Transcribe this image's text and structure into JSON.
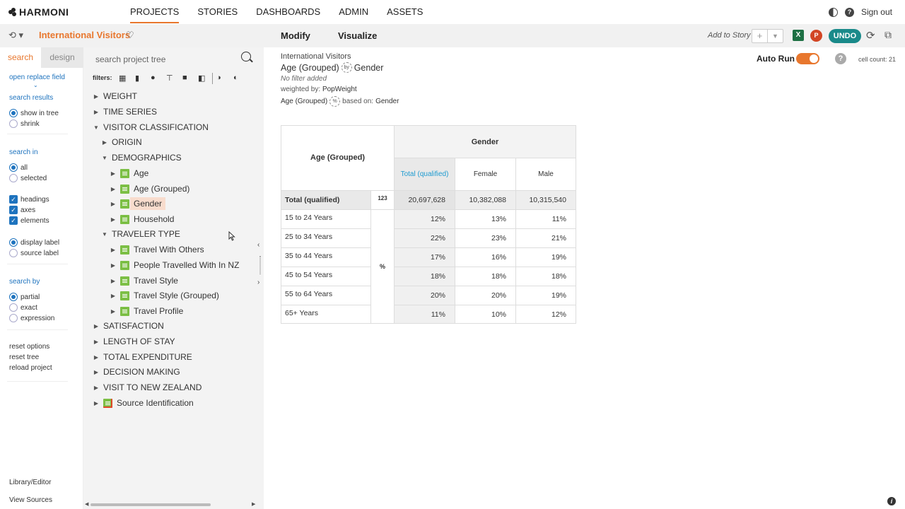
{
  "app": {
    "brand": "HARMONI"
  },
  "nav": {
    "links": [
      "PROJECTS",
      "STORIES",
      "DASHBOARDS",
      "ADMIN",
      "ASSETS"
    ],
    "active": "PROJECTS",
    "signout": "Sign out"
  },
  "toolbar": {
    "project_title": "International Visitors",
    "modify": "Modify",
    "visualize": "Visualize",
    "add_to_story": "Add to Story",
    "plus": "+",
    "excel": "X",
    "ppt": "P",
    "undo": "UNDO"
  },
  "options": {
    "tab_search": "search",
    "tab_design": "design",
    "open_replace_field": "open replace field",
    "search_results": "search results",
    "show_in_tree": "show in tree",
    "shrink": "shrink",
    "search_in": "search in",
    "all": "all",
    "selected": "selected",
    "headings": "headings",
    "axes": "axes",
    "elements": "elements",
    "display_label": "display label",
    "source_label": "source label",
    "search_by": "search by",
    "partial": "partial",
    "exact": "exact",
    "expression": "expression",
    "reset_options": "reset options",
    "reset_tree": "reset tree",
    "reload_project": "reload project",
    "library_editor": "Library/Editor",
    "view_sources": "View Sources"
  },
  "tree": {
    "search_placeholder": "search project tree",
    "filters_label": "filters:",
    "nodes": {
      "weight": "WEIGHT",
      "time_series": "TIME SERIES",
      "visitor_classification": "VISITOR CLASSIFICATION",
      "origin": "ORIGIN",
      "demographics": "DEMOGRAPHICS",
      "age": "Age",
      "age_grouped": "Age (Grouped)",
      "gender": "Gender",
      "household": "Household",
      "traveler_type": "TRAVELER TYPE",
      "travel_with_others": "Travel With Others",
      "people_travelled": "People Travelled With In NZ",
      "travel_style": "Travel Style",
      "travel_style_grouped": "Travel Style (Grouped)",
      "travel_profile": "Travel Profile",
      "satisfaction": "SATISFACTION",
      "length_of_stay": "LENGTH OF STAY",
      "total_expenditure": "TOTAL EXPENDITURE",
      "decision_making": "DECISION MAKING",
      "visit_to_nz": "VISIT TO NEW ZEALAND",
      "source_identification": "Source Identification"
    },
    "selected": "Gender"
  },
  "report": {
    "project": "International Visitors",
    "row_var": "Age (Grouped)",
    "by": "by",
    "col_var": "Gender",
    "no_filter": "No filter added",
    "weighted_by_label": "weighted by:",
    "weighted_by": "PopWeight",
    "pct_row_var": "Age (Grouped)",
    "pct": "%",
    "based_on_label": "based on:",
    "based_on": "Gender",
    "auto_run": "Auto Run",
    "auto_run_on": true,
    "help": "?",
    "cell_count": "cell count: 21"
  },
  "table": {
    "row_header": "Age (Grouped)",
    "col_header": "Gender",
    "columns": [
      "Total (qualified)",
      "Female",
      "Male"
    ],
    "total_row": {
      "label": "Total (qualified)",
      "base": "123",
      "values": [
        "20,697,628",
        "10,382,088",
        "10,315,540"
      ]
    },
    "stat_label": "%",
    "rows": [
      {
        "label": "15 to 24 Years",
        "values": [
          "12%",
          "13%",
          "11%"
        ]
      },
      {
        "label": "25 to 34 Years",
        "values": [
          "22%",
          "23%",
          "21%"
        ]
      },
      {
        "label": "35 to 44 Years",
        "values": [
          "17%",
          "16%",
          "19%"
        ]
      },
      {
        "label": "45 to 54 Years",
        "values": [
          "18%",
          "18%",
          "18%"
        ]
      },
      {
        "label": "55 to 64 Years",
        "values": [
          "20%",
          "20%",
          "19%"
        ]
      },
      {
        "label": "65+ Years",
        "values": [
          "11%",
          "10%",
          "12%"
        ]
      }
    ]
  },
  "colors": {
    "accent": "#e8772e",
    "link": "#1e73be",
    "undo": "#1a8a8a",
    "variable": "#7cbf45"
  }
}
